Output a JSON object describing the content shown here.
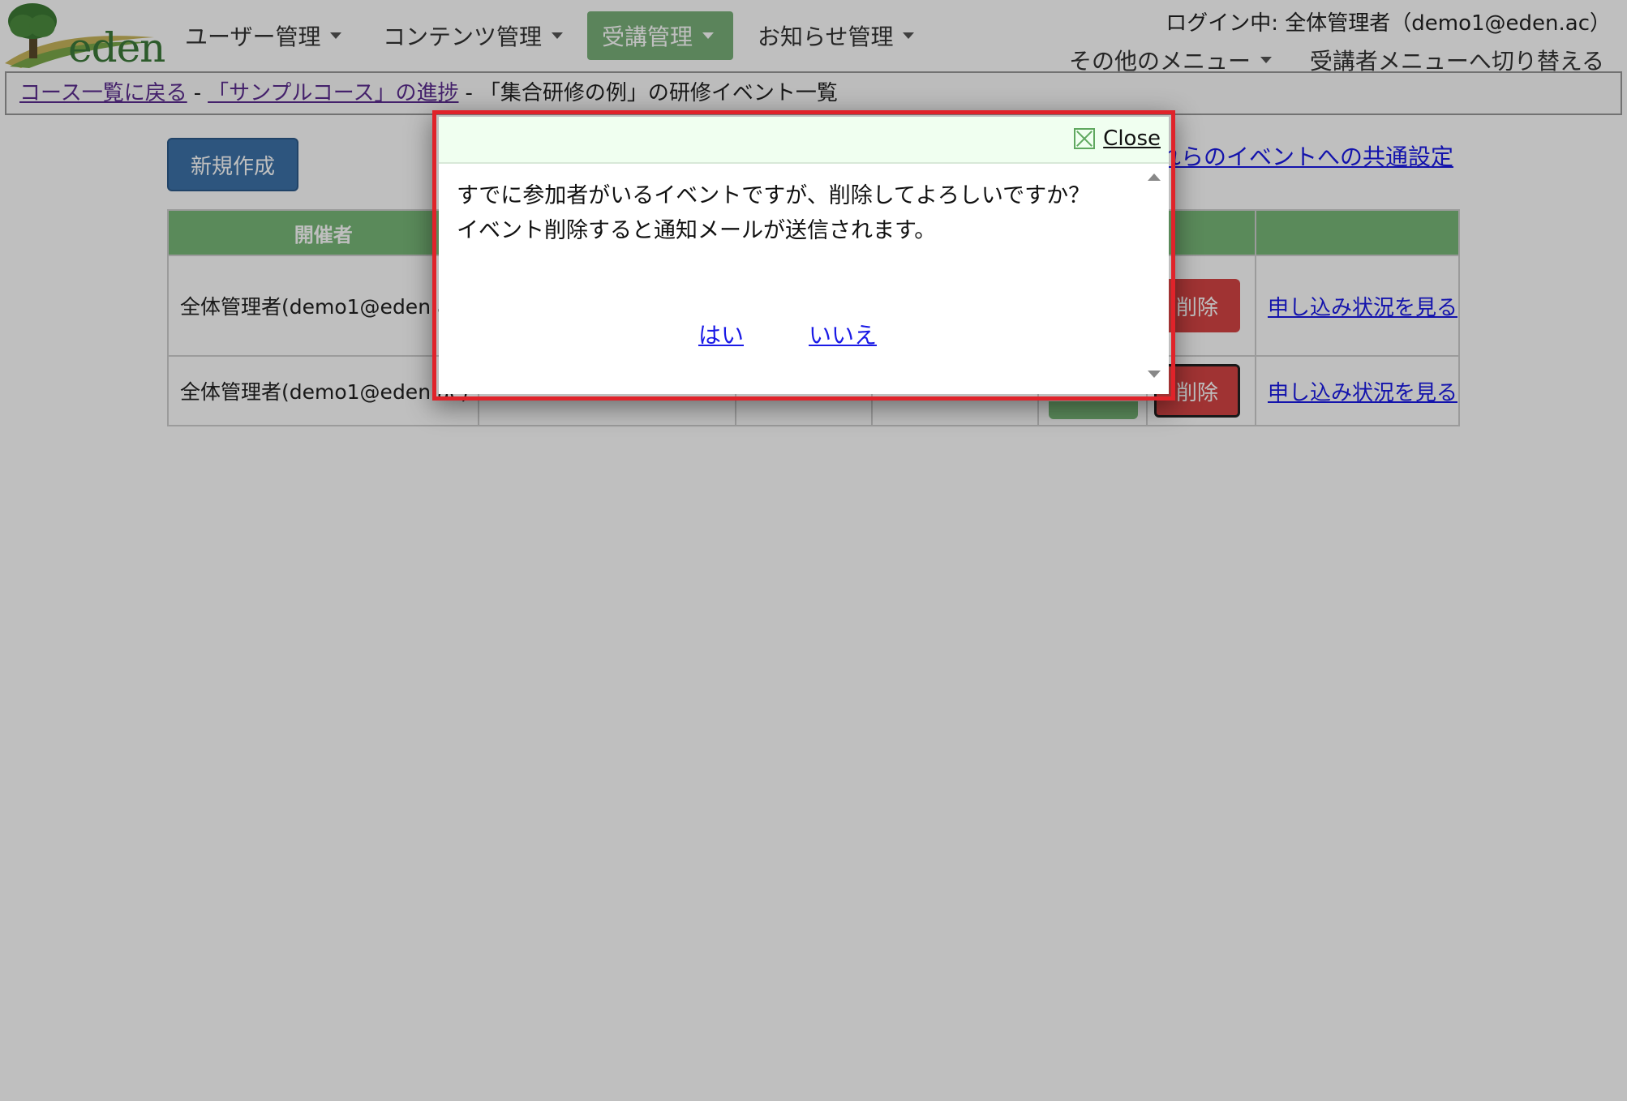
{
  "header": {
    "logo_text": "eden",
    "nav": [
      {
        "label": "ユーザー管理",
        "active": false
      },
      {
        "label": "コンテンツ管理",
        "active": false
      },
      {
        "label": "受講管理",
        "active": true
      },
      {
        "label": "お知らせ管理",
        "active": false
      }
    ],
    "login_info": "ログイン中: 全体管理者（demo1@eden.ac）",
    "other_menu": "その他のメニュー",
    "switch_link": "受講者メニューへ切り替える"
  },
  "breadcrumb": {
    "back_to_courses": "コース一覧に戻る",
    "sep1": "-",
    "course_progress": "「サンプルコース」の進捗",
    "sep2": "-",
    "current": "「集合研修の例」の研修イベント一覧"
  },
  "main": {
    "new_button": "新規作成",
    "common_settings_link": "これらのイベントへの共通設定",
    "table": {
      "headers": [
        "開催者",
        "",
        "",
        "",
        "",
        "",
        ""
      ],
      "rows": [
        {
          "organizer": "全体管理者(demo1@eden.ac)",
          "delete": "削除",
          "apply": "申し込み状況を見る"
        },
        {
          "organizer": "全体管理者(demo1@eden.ac)",
          "delete": "削除",
          "apply": "申し込み状況を見る"
        }
      ]
    }
  },
  "dialog": {
    "close_label": "Close",
    "message_line1": "すでに参加者がいるイベントですが、削除してよろしいですか？",
    "message_line2": "イベント削除すると通知メールが送信されます。",
    "yes_label": "はい",
    "no_label": "いいえ"
  },
  "colors": {
    "nav_active": "#7ab07a",
    "table_header": "#79b978",
    "new_button": "#3c72a8",
    "delete_button": "#d64545",
    "highlight_border": "#e0232a",
    "link": "#1a1ae6"
  }
}
